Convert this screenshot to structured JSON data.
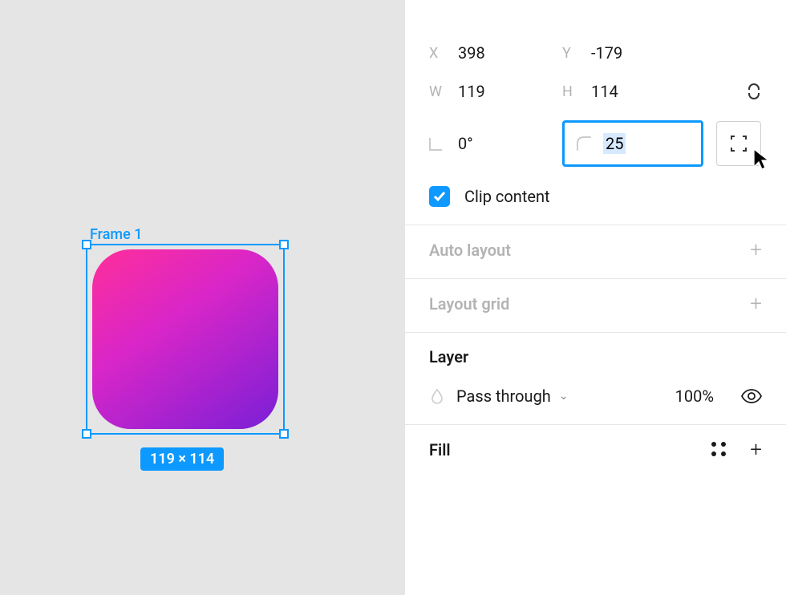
{
  "canvas": {
    "frame_label": "Frame 1",
    "dimensions_label": "119 × 114"
  },
  "transform": {
    "x_label": "X",
    "x_value": "398",
    "y_label": "Y",
    "y_value": "-179",
    "w_label": "W",
    "w_value": "119",
    "h_label": "H",
    "h_value": "114",
    "rotation_value": "0°",
    "radius_value": "25"
  },
  "clip": {
    "label": "Clip content",
    "checked": true
  },
  "sections": {
    "auto_layout": "Auto layout",
    "layout_grid": "Layout grid",
    "layer": "Layer",
    "fill": "Fill"
  },
  "layer": {
    "blend_mode": "Pass through",
    "opacity": "100%"
  }
}
